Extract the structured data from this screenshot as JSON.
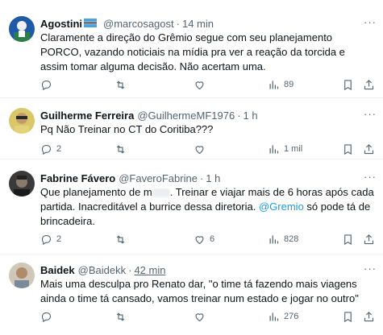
{
  "tweets": [
    {
      "name": "Agostini",
      "handle": "@marcosagost",
      "separator": "·",
      "time": "14 min",
      "text": "Claramente a direção do Grêmio segue com seu planejamento PORCO, vazando noticiais na mídia pra ver a reação da torcida e assim tomar alguma decisão. Não acertam uma.",
      "replies": "",
      "retweets": "",
      "likes": "",
      "views": "89"
    },
    {
      "name": "Guilherme Ferreira",
      "handle": "@GuilhermeMF1976",
      "separator": "·",
      "time": "1 h",
      "text": "Pq Não Treinar no CT do Coritiba???",
      "replies": "2",
      "retweets": "",
      "likes": "",
      "views": "1 mil"
    },
    {
      "name": "Fabrine Fávero",
      "handle": "@FaveroFabrine",
      "separator": "·",
      "time": "1 h",
      "text_part1": "Que planejamento de m",
      "text_part2": ". Treinar e viajar mais de 6 horas após cada partida. Inacreditável a burrice dessa diretoria. ",
      "mention": "@Gremio",
      "text_part3": " só pode tá de brincadeira.",
      "replies": "2",
      "retweets": "",
      "likes": "6",
      "views": "828"
    },
    {
      "name": "Baidek",
      "handle": "@Baidekk",
      "separator": "·",
      "time": "42 min",
      "text": "Mais uma desculpa pro Renato dar, \"o time tá fazendo mais viagens ainda o time tá cansado, vamos treinar num estado e jogar no outro\"",
      "replies": "",
      "retweets": "",
      "likes": "",
      "views": "276"
    }
  ],
  "more_label": "···",
  "icons": [
    "reply-icon",
    "retweet-icon",
    "like-icon",
    "views-icon",
    "bookmark-icon",
    "share-icon",
    "more-icon"
  ],
  "colors": {
    "text": "#0f1419",
    "secondary": "#536471",
    "link": "#1d9bf0",
    "divider": "#eff3f4"
  }
}
